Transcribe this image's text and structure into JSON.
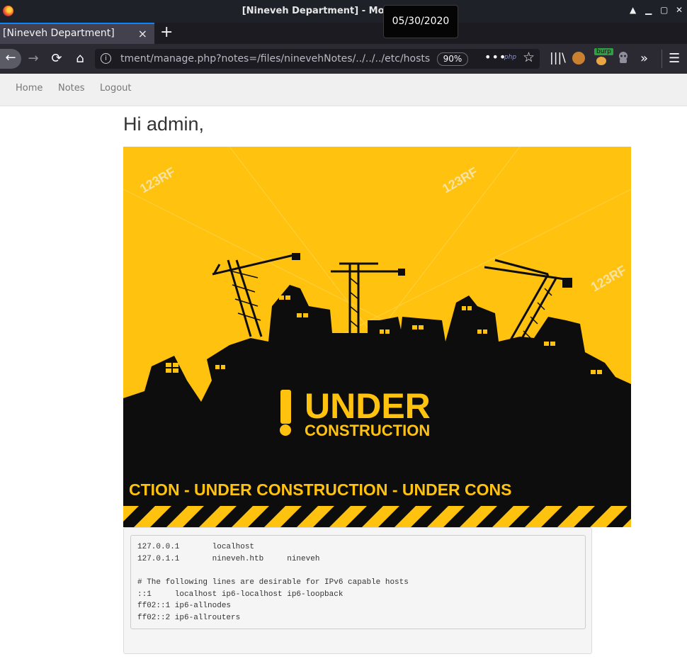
{
  "window": {
    "title": "[Nineveh Department] - Mozilla Firefox",
    "controls": {
      "up": "▲",
      "minimize": "▁",
      "maximize": "▢",
      "close": "✕"
    }
  },
  "tooltip": {
    "date": "05/30/2020"
  },
  "tab": {
    "label": "[Nineveh Department]",
    "close": "×",
    "new_tab": "+"
  },
  "toolbar": {
    "back": "←",
    "forward": "→",
    "reload": "⟳",
    "home": "⌂",
    "url": "tment/manage.php?notes=/files/ninevehNotes/../../../etc/hosts",
    "zoom": "90%",
    "page_actions": "•••",
    "php_badge": "php",
    "bookmark": "☆",
    "library": "|||\\",
    "burp_label": "burp",
    "overflow": "»",
    "menu": "☰"
  },
  "nav": {
    "home": "Home",
    "notes": "Notes",
    "logout": "Logout"
  },
  "greeting": "Hi admin,",
  "banner": {
    "title_main": "UNDER",
    "title_sub": "CONSTRUCTION",
    "strip_text": "CTION - UNDER  CONSTRUCTION - UNDER  CONS",
    "watermark": "123RF"
  },
  "hosts_lines": [
    "127.0.0.1       localhost",
    "127.0.1.1       nineveh.htb     nineveh",
    "",
    "# The following lines are desirable for IPv6 capable hosts",
    "::1     localhost ip6-localhost ip6-loopback",
    "ff02::1 ip6-allnodes",
    "ff02::2 ip6-allrouters"
  ],
  "colors": {
    "accent": "#0a84ff",
    "banner_yellow": "#ffc20e",
    "banner_black": "#0d0d0d"
  }
}
